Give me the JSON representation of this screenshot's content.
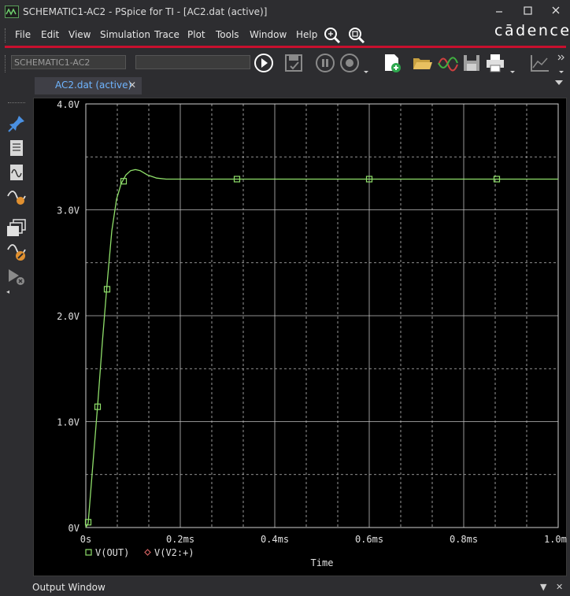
{
  "window": {
    "title": "SCHEMATIC1-AC2 - PSpice for TI - [AC2.dat (active)]",
    "minimize_icon": "minimize-icon",
    "maximize_icon": "maximize-icon",
    "close_icon": "close-icon"
  },
  "menu": {
    "items": [
      "File",
      "Edit",
      "View",
      "Simulation",
      "Trace",
      "Plot",
      "Tools",
      "Window",
      "Help"
    ],
    "icons": [
      "zoom-area-icon",
      "zoom-fit-icon"
    ]
  },
  "brand": {
    "logo": "cādence®",
    "accent": "#c8102e"
  },
  "toolbar": {
    "profile_combo": "SCHEMATIC1-AC2",
    "second_combo": "",
    "icons": [
      "run-icon",
      "save-settings-icon",
      "pause-icon",
      "stop-icon",
      "new-profile-icon",
      "open-icon",
      "waveform-icon",
      "save-icon",
      "print-icon",
      "axis-settings-icon"
    ]
  },
  "tab": {
    "label": "AC2.dat (active)"
  },
  "left_tools": {
    "icons": [
      "pin-icon",
      "simulation-settings-icon",
      "view-simulation-results-icon",
      "evaluate-measurement-icon",
      "new-window-icon",
      "edit-probe-icon",
      "disable-simulation-icon"
    ]
  },
  "chart_data": {
    "type": "line",
    "xlabel": "Time",
    "ylabel": "",
    "x_tick_labels": [
      "0s",
      "0.2ms",
      "0.4ms",
      "0.6ms",
      "0.8ms",
      "1.0ms"
    ],
    "y_tick_labels": [
      "0V",
      "1.0V",
      "2.0V",
      "3.0V",
      "4.0V"
    ],
    "xlim": [
      0,
      1.0
    ],
    "ylim": [
      0,
      4.0
    ],
    "x_unit": "ms",
    "y_unit": "V",
    "grid": true,
    "legend_position": "bottom-left",
    "background": "#000000",
    "series": [
      {
        "name": "V(OUT)",
        "color": "#8fdf6a",
        "marker": "square",
        "x": [
          0,
          0.005,
          0.015,
          0.025,
          0.035,
          0.045,
          0.055,
          0.065,
          0.075,
          0.085,
          0.095,
          0.105,
          0.115,
          0.13,
          0.15,
          0.17,
          0.2,
          0.25,
          0.3,
          0.4,
          0.6,
          0.8,
          1.0
        ],
        "y": [
          0.0,
          0.04,
          0.6,
          1.15,
          1.75,
          2.3,
          2.8,
          3.1,
          3.25,
          3.33,
          3.37,
          3.38,
          3.37,
          3.33,
          3.3,
          3.29,
          3.29,
          3.29,
          3.29,
          3.29,
          3.29,
          3.29,
          3.29
        ],
        "marker_x": [
          0.005,
          0.025,
          0.045,
          0.08,
          0.32,
          0.6,
          0.87
        ],
        "marker_y": [
          0.05,
          1.14,
          2.25,
          3.27,
          3.29,
          3.29,
          3.29
        ]
      },
      {
        "name": "V(V2:+)",
        "color": "#d06060",
        "marker": "diamond",
        "x": [],
        "y": []
      }
    ]
  },
  "output_window": {
    "label": "Output Window"
  }
}
